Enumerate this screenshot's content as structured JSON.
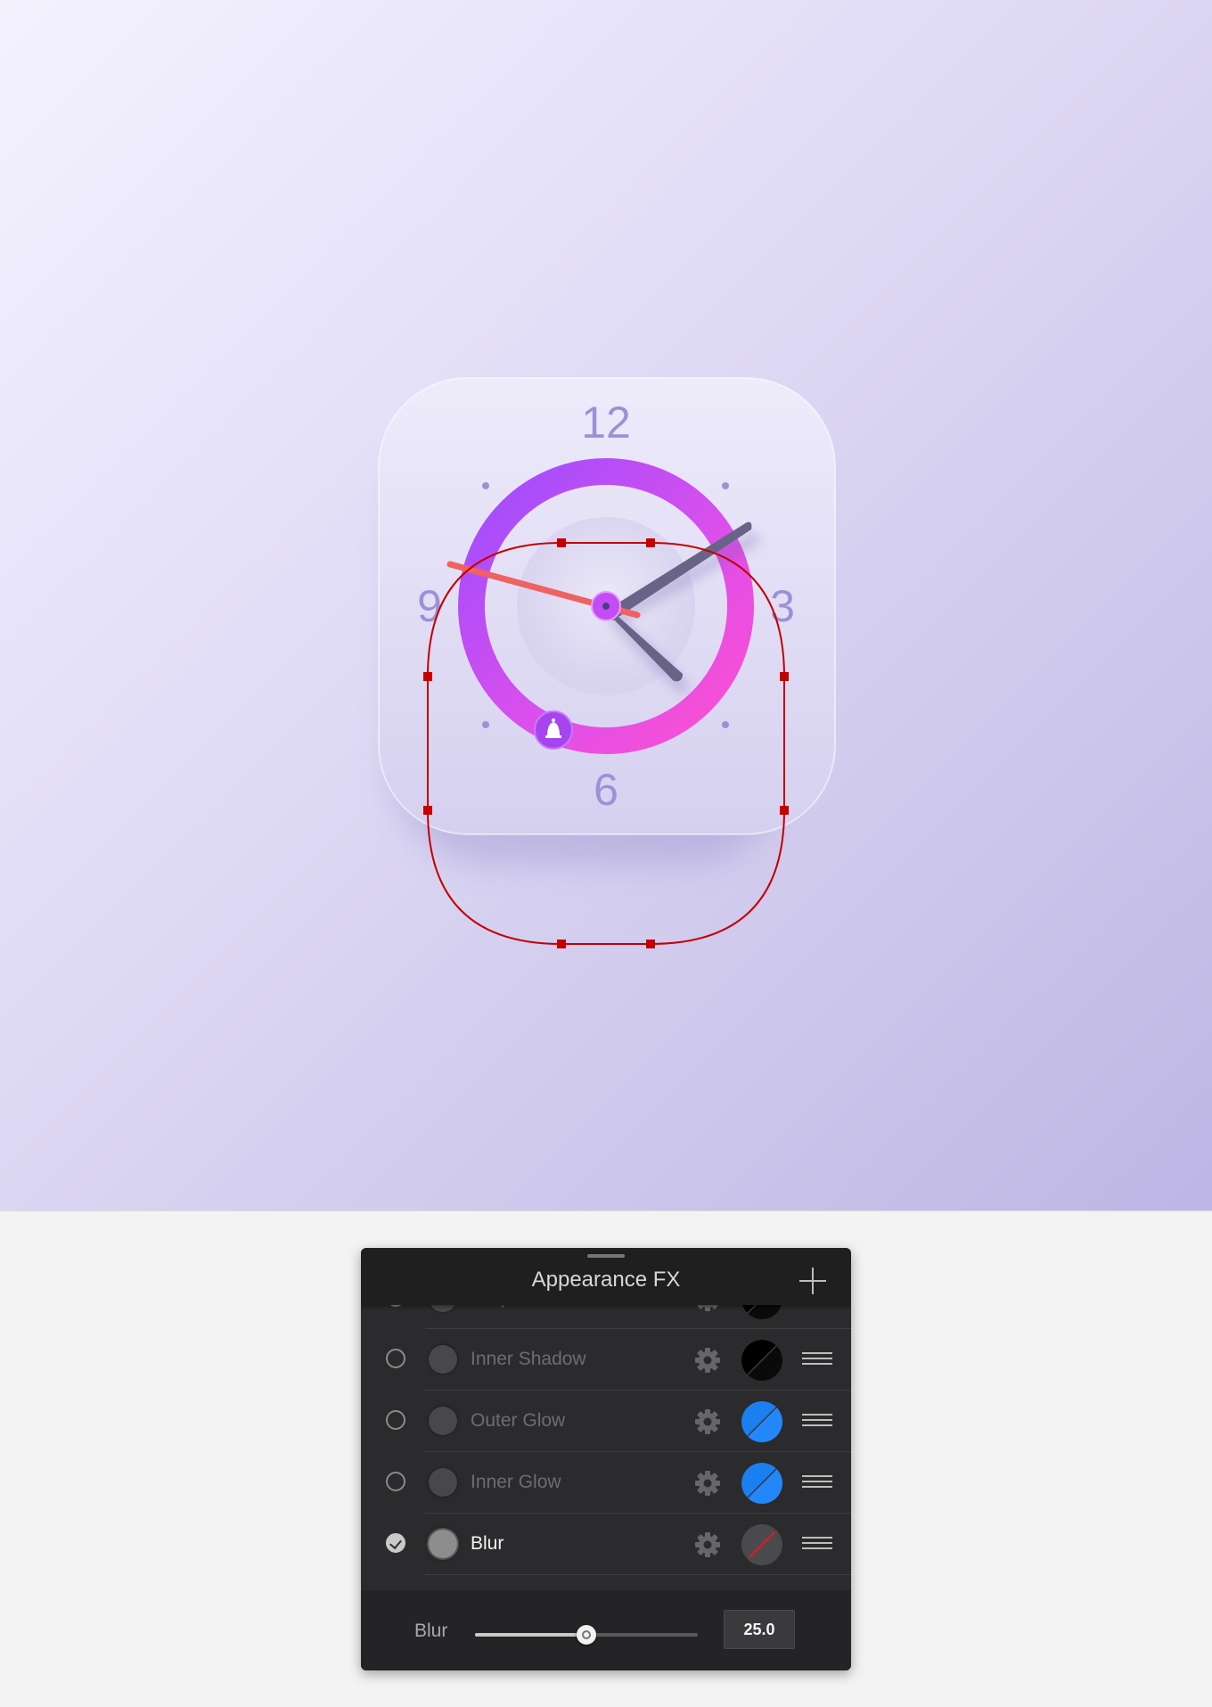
{
  "canvas": {
    "clock": {
      "numerals": {
        "twelve": "12",
        "three": "3",
        "six": "6",
        "nine": "9"
      },
      "ring_gradient": [
        "#9b4dff",
        "#ff4fd1"
      ],
      "hand_color": "#676487",
      "second_hand_color": "#ef6262",
      "face_color": "#e4e0f5"
    },
    "selection_color": "#c40000"
  },
  "panel": {
    "title": "Appearance FX",
    "add_icon": "plus-icon",
    "effects": [
      {
        "label": "Drop Shadow",
        "enabled": false,
        "swatch": "black",
        "swatch_color": "#000000"
      },
      {
        "label": "Inner Shadow",
        "enabled": false,
        "swatch": "black",
        "swatch_color": "#000000"
      },
      {
        "label": "Outer Glow",
        "enabled": false,
        "swatch": "blue",
        "swatch_color": "#1a7ff0"
      },
      {
        "label": "Inner Glow",
        "enabled": false,
        "swatch": "blue",
        "swatch_color": "#1a7ff0"
      },
      {
        "label": "Blur",
        "enabled": true,
        "swatch": "none",
        "swatch_color": "#4a4a4c"
      }
    ],
    "blur": {
      "label": "Blur",
      "value": "25.0",
      "slider_fraction": 0.5
    }
  }
}
